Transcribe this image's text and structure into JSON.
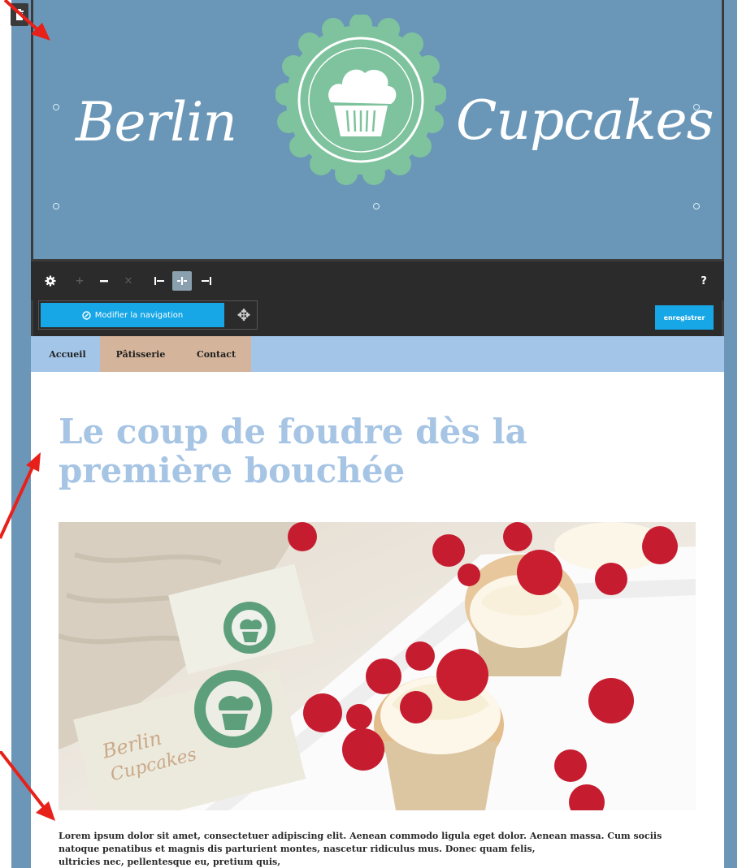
{
  "brand": {
    "name_left": "Berlin",
    "name_right": "Cupcakes"
  },
  "toolbar": {
    "help_label": "?"
  },
  "editor": {
    "modify_nav_label": "Modifier la navigation",
    "save_label": "enregistrer"
  },
  "nav": {
    "items": [
      {
        "label": "Accueil"
      },
      {
        "label": "Pâtisserie"
      },
      {
        "label": "Contact"
      }
    ]
  },
  "main": {
    "headline": "Le coup de foudre dès la première bouchée",
    "paragraph": "Lorem ipsum dolor sit amet, consectetuer adipiscing elit. Aenean commodo ligula eget dolor. Aenean massa. Cum sociis natoque penatibus et magnis dis parturient montes, nascetur ridiculus mus. Donec quam felis,",
    "paragraph_cut": "ultricies nec, pellentesque eu, pretium quis,",
    "card_text": "Berlin Cupcakes"
  },
  "colors": {
    "frame": "#6b96b8",
    "header_bg": "#6a97b8",
    "badge_green": "#7ec39d",
    "toolbar": "#2b2b2b",
    "accent_blue": "#17a6e6",
    "nav_bg": "#a3c6e8",
    "nav_active": "#d4b49a",
    "headline": "#a6c4e3",
    "arrow": "#e8201a"
  }
}
